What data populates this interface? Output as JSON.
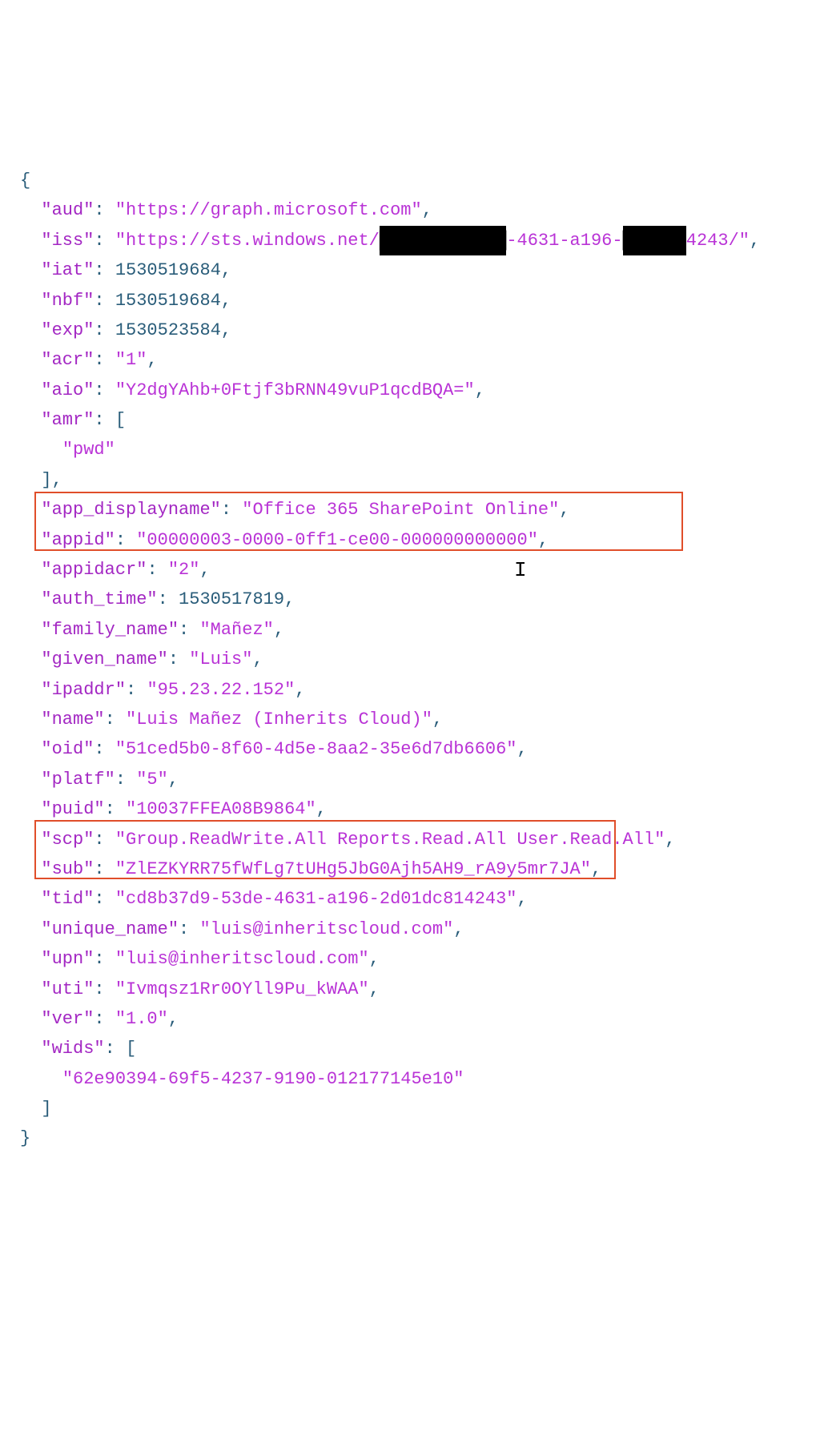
{
  "code": {
    "open_brace": "{",
    "close_brace": "}",
    "lines": {
      "aud": {
        "k": "\"aud\"",
        "c": ": ",
        "v": "\"https://graph.microsoft.com\"",
        "e": ","
      },
      "iss": {
        "k": "\"iss\"",
        "c": ": ",
        "v_pre": "\"https://sts.windows.net/",
        "red1": "████████████",
        "v_mid1": "-4631-a196-",
        "red2": "██████",
        "v_mid2": "4243/\"",
        "e": ","
      },
      "iat": {
        "k": "\"iat\"",
        "c": ": ",
        "v": "1530519684",
        "e": ","
      },
      "nbf": {
        "k": "\"nbf\"",
        "c": ": ",
        "v": "1530519684",
        "e": ","
      },
      "exp": {
        "k": "\"exp\"",
        "c": ": ",
        "v": "1530523584",
        "e": ","
      },
      "acr": {
        "k": "\"acr\"",
        "c": ": ",
        "v": "\"1\"",
        "e": ","
      },
      "aio": {
        "k": "\"aio\"",
        "c": ": ",
        "v": "\"Y2dgYAhb+0Ftjf3bRNN49vuP1qcdBQA=\"",
        "e": ","
      },
      "amr": {
        "k": "\"amr\"",
        "c": ": ",
        "open": "[",
        "item": "\"pwd\"",
        "close": "]",
        "e": ","
      },
      "app_displayname": {
        "k": "\"app_displayname\"",
        "c": ": ",
        "v": "\"Office 365 SharePoint Online\"",
        "e": ","
      },
      "appid": {
        "k": "\"appid\"",
        "c": ": ",
        "v": "\"00000003-0000-0ff1-ce00-000000000000\"",
        "e": ","
      },
      "appidacr": {
        "k": "\"appidacr\"",
        "c": ": ",
        "v": "\"2\"",
        "e": ","
      },
      "auth_time": {
        "k": "\"auth_time\"",
        "c": ": ",
        "v": "1530517819",
        "e": ","
      },
      "family_name": {
        "k": "\"family_name\"",
        "c": ": ",
        "v": "\"Mañez\"",
        "e": ","
      },
      "given_name": {
        "k": "\"given_name\"",
        "c": ": ",
        "v": "\"Luis\"",
        "e": ","
      },
      "ipaddr": {
        "k": "\"ipaddr\"",
        "c": ": ",
        "v": "\"95.23.22.152\"",
        "e": ","
      },
      "name": {
        "k": "\"name\"",
        "c": ": ",
        "v": "\"Luis Mañez (Inherits Cloud)\"",
        "e": ","
      },
      "oid": {
        "k": "\"oid\"",
        "c": ": ",
        "v": "\"51ced5b0-8f60-4d5e-8aa2-35e6d7db6606\"",
        "e": ","
      },
      "platf": {
        "k": "\"platf\"",
        "c": ": ",
        "v": "\"5\"",
        "e": ","
      },
      "puid": {
        "k": "\"puid\"",
        "c": ": ",
        "v": "\"10037FFEA08B9864\"",
        "e": ","
      },
      "scp": {
        "k": "\"scp\"",
        "c": ": ",
        "v": "\"Group.ReadWrite.All Reports.Read.All User.Read.All\"",
        "e": ","
      },
      "sub": {
        "k": "\"sub\"",
        "c": ": ",
        "v": "\"ZlEZKYRR75fWfLg7tUHg5JbG0Ajh5AH9_rA9y5mr7JA\"",
        "e": ","
      },
      "tid": {
        "k": "\"tid\"",
        "c": ": ",
        "v": "\"cd8b37d9-53de-4631-a196-2d01dc814243\"",
        "e": ","
      },
      "unique_name": {
        "k": "\"unique_name\"",
        "c": ": ",
        "v": "\"luis@inheritscloud.com\"",
        "e": ","
      },
      "upn": {
        "k": "\"upn\"",
        "c": ": ",
        "v": "\"luis@inheritscloud.com\"",
        "e": ","
      },
      "uti": {
        "k": "\"uti\"",
        "c": ": ",
        "v": "\"Ivmqsz1Rr0OYll9Pu_kWAA\"",
        "e": ","
      },
      "ver": {
        "k": "\"ver\"",
        "c": ": ",
        "v": "\"1.0\"",
        "e": ","
      },
      "wids": {
        "k": "\"wids\"",
        "c": ": ",
        "open": "[",
        "item": "\"62e90394-69f5-4237-9190-012177145e10\"",
        "close": "]",
        "e": ""
      }
    }
  }
}
